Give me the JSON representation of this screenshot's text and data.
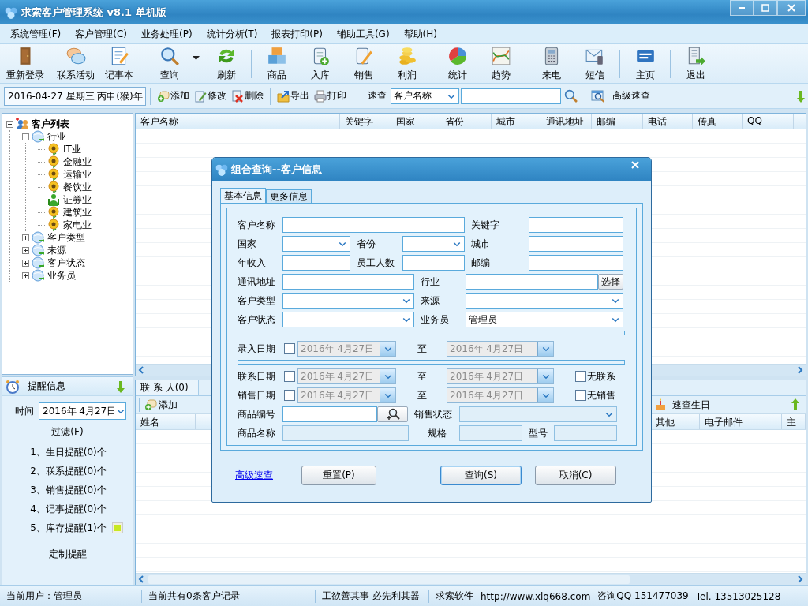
{
  "window": {
    "title": "求索客户管理系统 v8.1 单机版"
  },
  "menu": [
    {
      "label": "系统管理(F)"
    },
    {
      "label": "客户管理(C)"
    },
    {
      "label": "业务处理(P)"
    },
    {
      "label": "统计分析(T)"
    },
    {
      "label": "报表打印(P)"
    },
    {
      "label": "辅助工具(G)"
    },
    {
      "label": "帮助(H)"
    }
  ],
  "toolbar": {
    "groups": [
      [
        {
          "label": "重新登录",
          "menu": false
        }
      ],
      [
        {
          "label": "联系活动",
          "menu": false
        },
        {
          "label": "记事本",
          "menu": false
        }
      ],
      [
        {
          "label": "查询",
          "menu": true
        },
        {
          "label": "刷新",
          "menu": false
        }
      ],
      [
        {
          "label": "商品",
          "menu": false
        },
        {
          "label": "入库",
          "menu": false
        },
        {
          "label": "销售",
          "menu": false
        },
        {
          "label": "利润",
          "menu": false
        }
      ],
      [
        {
          "label": "统计",
          "menu": false
        },
        {
          "label": "趋势",
          "menu": false
        }
      ],
      [
        {
          "label": "来电",
          "menu": false
        },
        {
          "label": "短信",
          "menu": false
        }
      ],
      [
        {
          "label": "主页",
          "menu": false
        }
      ],
      [
        {
          "label": "退出",
          "menu": false
        }
      ]
    ]
  },
  "action_bar": {
    "date": "2016-04-27 星期三 丙申(猴)年",
    "groups": [
      [
        {
          "label": "添加"
        },
        {
          "label": "修改"
        },
        {
          "label": "删除"
        }
      ],
      [
        {
          "label": "导出"
        },
        {
          "label": "打印"
        }
      ]
    ],
    "quick_search": {
      "label": "速查",
      "field": "客户名称",
      "advanced": "高级速查"
    }
  },
  "tree": {
    "label": "客户列表",
    "expanded": true,
    "children": [
      {
        "label": "行业",
        "expanded": true,
        "children": [
          {
            "label": "IT业",
            "kind": "flower"
          },
          {
            "label": "金融业",
            "kind": "flower"
          },
          {
            "label": "运输业",
            "kind": "flower"
          },
          {
            "label": "餐饮业",
            "kind": "flower"
          },
          {
            "label": "证券业",
            "kind": "person"
          },
          {
            "label": "建筑业",
            "kind": "flower"
          },
          {
            "label": "家电业",
            "kind": "flower"
          }
        ]
      },
      {
        "label": "客户类型",
        "expanded": false
      },
      {
        "label": "来源",
        "expanded": false
      },
      {
        "label": "客户状态",
        "expanded": false
      },
      {
        "label": "业务员",
        "expanded": false
      }
    ]
  },
  "reminders": {
    "title": "提醒信息",
    "time_label": "时间",
    "date": "2016年 4月27日",
    "filter": "过滤(F)",
    "items": [
      {
        "text": "1、生日提醒(0)个",
        "alert": false
      },
      {
        "text": "2、联系提醒(0)个",
        "alert": false
      },
      {
        "text": "3、销售提醒(0)个",
        "alert": false
      },
      {
        "text": "4、记事提醒(0)个",
        "alert": false
      },
      {
        "text": "5、库存提醒(1)个",
        "alert": true
      }
    ],
    "customize": "定制提醒"
  },
  "customer_table": {
    "columns": [
      "客户名称",
      "关键字",
      "国家",
      "省份",
      "城市",
      "通讯地址",
      "邮编",
      "电话",
      "传真",
      "QQ"
    ]
  },
  "contacts": {
    "tabs": [
      {
        "label": "联 系 人(0)",
        "selected": true
      }
    ],
    "toolbar": [
      {
        "label": "添加"
      },
      {
        "label": "速查生日"
      }
    ],
    "columns": [
      "姓名",
      "其他",
      "电子邮件",
      "主"
    ]
  },
  "dialog": {
    "title": "组合查询--客户信息",
    "tabs": [
      {
        "label": "基本信息",
        "selected": true
      },
      {
        "label": "更多信息",
        "selected": false
      }
    ],
    "fields": [
      [
        {
          "label": "客户名称",
          "kind": "text"
        },
        {
          "label": "关键字",
          "kind": "text"
        }
      ],
      [
        {
          "label": "国家",
          "kind": "select"
        },
        {
          "label": "省份",
          "kind": "select"
        },
        {
          "label": "城市",
          "kind": "text"
        }
      ],
      [
        {
          "label": "年收入",
          "kind": "text"
        },
        {
          "label": "员工人数",
          "kind": "text"
        },
        {
          "label": "邮编",
          "kind": "text"
        }
      ],
      [
        {
          "label": "通讯地址",
          "kind": "text"
        },
        {
          "label": "行业",
          "kind": "text_button",
          "button": "选择"
        }
      ],
      [
        {
          "label": "客户类型",
          "kind": "select"
        },
        {
          "label": "来源",
          "kind": "select"
        }
      ],
      [
        {
          "label": "客户状态",
          "kind": "select"
        },
        {
          "label": "业务员",
          "kind": "select",
          "value": "管理员"
        }
      ]
    ],
    "dates": [
      {
        "label": "录入日期",
        "checked": false,
        "disabled": true,
        "from": "2016年 4月27日",
        "to_label": "至",
        "to": "2016年 4月27日"
      },
      {
        "label": "联系日期",
        "checked": false,
        "disabled": true,
        "from": "2016年 4月27日",
        "to_label": "至",
        "to": "2016年 4月27日",
        "extra": {
          "label": "无联系",
          "checked": false
        }
      },
      {
        "label": "销售日期",
        "checked": false,
        "disabled": true,
        "from": "2016年 4月27日",
        "to_label": "至",
        "to": "2016年 4月27日",
        "extra": {
          "label": "无销售",
          "checked": false
        }
      }
    ],
    "goods": [
      [
        {
          "label": "商品编号",
          "kind": "lookup",
          "disabled": false
        },
        {
          "label": "销售状态",
          "kind": "select",
          "disabled": true
        }
      ],
      [
        {
          "label": "商品名称",
          "kind": "text",
          "disabled": true
        },
        {
          "label": "规格",
          "kind": "text",
          "disabled": true
        },
        {
          "label": "型号",
          "kind": "text",
          "disabled": true
        }
      ]
    ],
    "link": "高级速查",
    "buttons": [
      {
        "label": "重置(P)",
        "default": false
      },
      {
        "label": "查询(S)",
        "default": true
      },
      {
        "label": "取消(C)",
        "default": false
      }
    ]
  },
  "status_bar": [
    {
      "texts": [
        "当前用户：管理员"
      ]
    },
    {
      "texts": [
        "当前共有0条客户记录"
      ]
    },
    {
      "texts": [
        "工欲善其事 必先利其器"
      ]
    },
    {
      "texts": [
        "求索软件",
        "http://www.xlq668.com",
        "咨询QQ 151477039",
        "Tel. 13513025128"
      ]
    }
  ]
}
